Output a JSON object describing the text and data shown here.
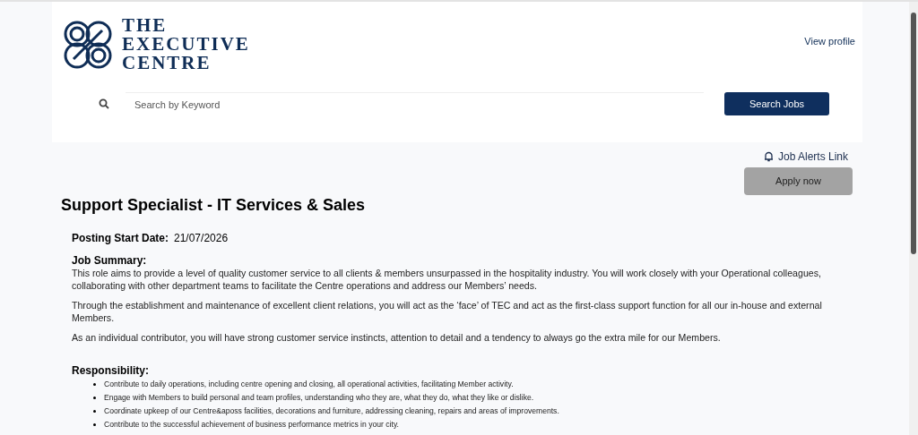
{
  "logo": {
    "lines": [
      "THE",
      "EXECUTIVE",
      "CENTRE"
    ]
  },
  "header": {
    "view_profile": "View profile"
  },
  "search": {
    "placeholder": "Search by Keyword",
    "button": "Search Jobs"
  },
  "job_alerts": "Job Alerts Link",
  "apply_button": {
    "label": "Apply now",
    "disabled": true
  },
  "job": {
    "title": "Support Specialist - IT Services & Sales",
    "posting_label": "Posting Start Date:",
    "posting_date": "21/07/2026",
    "summary_heading": "Job Summary:",
    "summary_paragraphs": [
      "This role aims to provide a level of quality customer service to all clients & members unsurpassed in the hospitality industry. You will work closely with your Operational colleagues, collaborating with other department teams to facilitate the Centre operations and address our Members’ needs.",
      "Through the establishment and maintenance of excellent client relations, you will act as the ‘face’ of TEC and act as the first-class support function for all our in-house and external Members.",
      "As an individual contributor, you will have strong customer service instincts, attention to detail and a tendency to always go the extra mile for our Members."
    ],
    "responsibility_heading": "Responsibility:",
    "responsibilities": [
      "Contribute to daily operations, including centre opening and closing, all operational activities, facilitating Member activity.",
      "Engage with Members to build personal and team profiles, understanding who they are, what they do, what they like or dislike.",
      "Coordinate upkeep of our Centre&aposs facilities, decorations and furniture, addressing cleaning, repairs and areas of improvements.",
      "Contribute to the successful achievement of business performance metrics in your city."
    ]
  }
}
